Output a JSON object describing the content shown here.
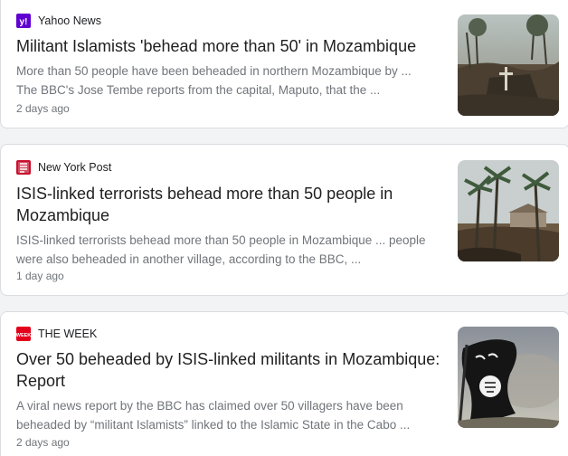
{
  "articles": [
    {
      "source": "Yahoo News",
      "favicon_icon": "yahoo-logo-icon",
      "favicon_color": "#6001d2",
      "headline": "Militant Islamists 'behead more than 50' in Mozambique",
      "snippet_line1": "More than 50 people have been beheaded in northern Mozambique by ...",
      "snippet_line2": "The BBC's Jose Tembe reports from the capital, Maputo, that the ...",
      "time": "2 days ago",
      "thumbnail": "burned-village-cross-photo"
    },
    {
      "source": "New York Post",
      "favicon_icon": "new-york-post-logo-icon",
      "favicon_color": "#c8102e",
      "headline_line1": "ISIS-linked terrorists behead more than 50 people in",
      "headline_line2": "Mozambique",
      "snippet_line1": "ISIS-linked terrorists behead more than 50 people in Mozambique ... people",
      "snippet_line2": "were also beheaded in another village, according to the BBC, ...",
      "time": "1 day ago",
      "thumbnail": "palm-trees-burned-huts-photo"
    },
    {
      "source": "THE WEEK",
      "favicon_icon": "the-week-logo-icon",
      "favicon_color": "#e3001b",
      "headline_line1": "Over 50 beheaded by ISIS-linked militants in Mozambique:",
      "headline_line2": "Report",
      "snippet_line1": "A viral news report by the BBC has claimed over 50 villagers have been",
      "snippet_line2": "beheaded by “militant Islamists” linked to the Islamic State in the Cabo ...",
      "time": "2 days ago",
      "thumbnail": "black-flag-smoke-photo"
    }
  ]
}
